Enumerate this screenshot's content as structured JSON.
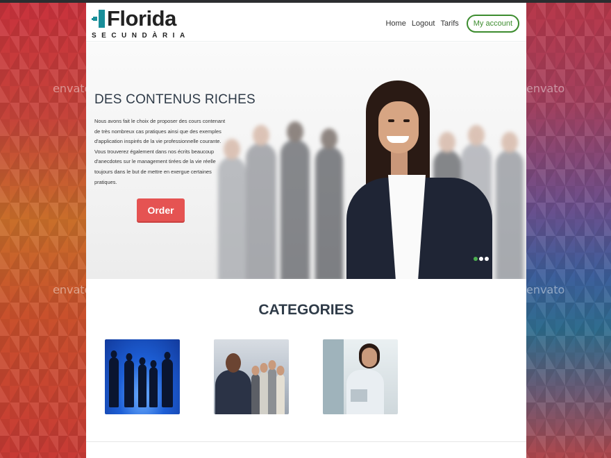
{
  "brand": {
    "name": "Florida",
    "subtitle": "SECUNDÀRIA"
  },
  "nav": {
    "home": "Home",
    "logout": "Logout",
    "tarifs": "Tarifs",
    "account": "My account"
  },
  "hero": {
    "title": "DES CONTENUS RICHES",
    "text": "Nous avons fait le choix de proposer des cours contenant de très nombreux cas pratiques ainsi que des exemples d'application inspirés de la vie professionnelle courante. Vous trouverez également dans nos écrits beaucoup d'anecdotes sur le management tirées de la vie réelle toujours dans le but de mettre en exergue certaines pratiques.",
    "order_label": "Order",
    "slides": 3,
    "active_slide": 1
  },
  "categories": {
    "title": "CATEGORIES"
  },
  "watermark": "envato",
  "colors": {
    "accent_green": "#3c8c2e",
    "order_red": "#e55352",
    "title_navy": "#2f3b48",
    "logo_teal": "#1a8f9a"
  }
}
